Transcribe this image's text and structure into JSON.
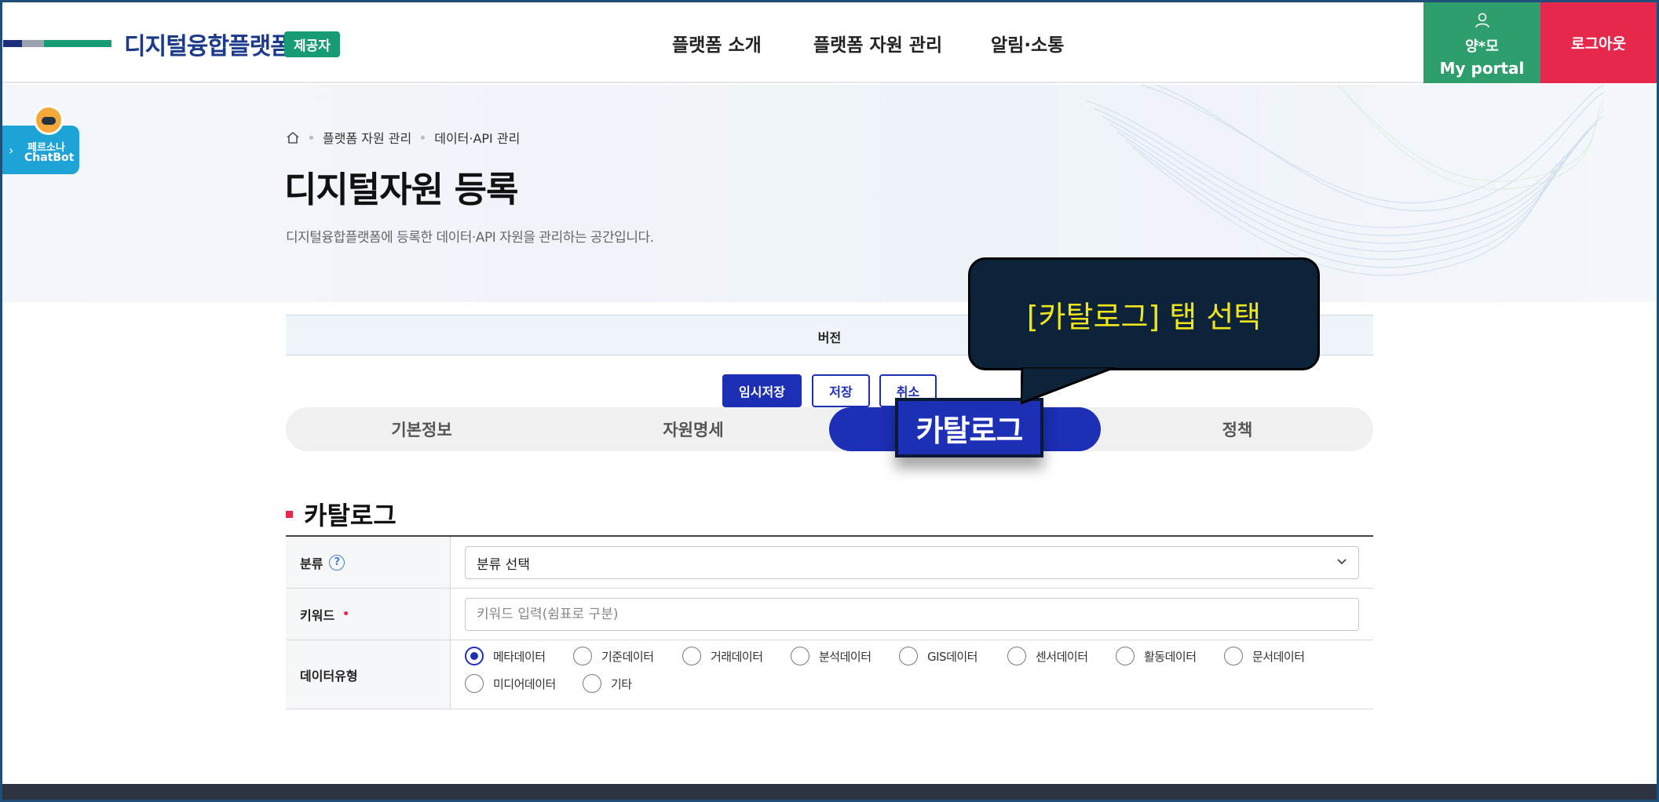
{
  "header": {
    "logo_text": "디지털융합플랫폼",
    "role_badge": "제공자",
    "nav": [
      "플랫폼 소개",
      "플랫폼 자원 관리",
      "알림·소통"
    ],
    "user_name": "양*모",
    "portal_label": "My portal",
    "logout_label": "로그아웃"
  },
  "chatbot": {
    "line1": "페르소나",
    "line2": "ChatBot"
  },
  "breadcrumb": [
    "플랫폼 자원 관리",
    "데이터·API 관리"
  ],
  "page": {
    "title": "디지털자원 등록",
    "description": "디지털융합플랫폼에 등록한 데이터·API 자원을 관리하는 공간입니다."
  },
  "version_label": "버전",
  "actions": {
    "temp_save": "임시저장",
    "save": "저장",
    "cancel": "취소"
  },
  "tabs": [
    "기본정보",
    "자원명세",
    "카탈로그",
    "정책"
  ],
  "active_tab": "카탈로그",
  "tooltip": "[카탈로그] 탭 선택",
  "catalog": {
    "title": "카탈로그",
    "category_label": "분류",
    "category_value": "분류 선택",
    "keyword_label": "키워드",
    "keyword_placeholder": "키워드 입력(쉼표로 구분)",
    "datatype_label": "데이터유형",
    "datatypes": [
      "메타데이터",
      "기준데이터",
      "거래데이터",
      "분석데이터",
      "GIS데이터",
      "센서데이터",
      "활동데이터",
      "문서데이터",
      "미디어데이터",
      "기타"
    ],
    "selected_datatype": "메타데이터"
  },
  "colors": {
    "primary": "#1c2fb5",
    "green": "#2e9e6c",
    "red": "#e6284c",
    "tooltip_bg": "#0c2339",
    "tooltip_text": "#f0e51c"
  }
}
